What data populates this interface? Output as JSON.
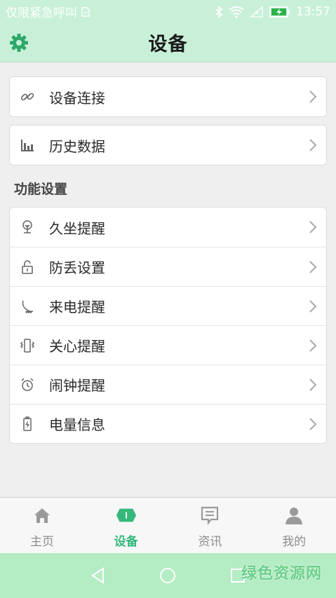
{
  "status_bar": {
    "carrier_text": "仅限紧急呼叫",
    "time": "13:57"
  },
  "header": {
    "title": "设备",
    "settings_icon": "gear-icon"
  },
  "top_items": [
    {
      "label": "设备连接",
      "icon": "link-icon"
    },
    {
      "label": "历史数据",
      "icon": "bar-chart-icon"
    }
  ],
  "function_section": {
    "title": "功能设置",
    "items": [
      {
        "label": "久坐提醒",
        "icon": "tree-icon"
      },
      {
        "label": "防丢设置",
        "icon": "unlock-icon"
      },
      {
        "label": "来电提醒",
        "icon": "phone-icon"
      },
      {
        "label": "关心提醒",
        "icon": "vibrate-icon"
      },
      {
        "label": "闹钟提醒",
        "icon": "alarm-icon"
      },
      {
        "label": "电量信息",
        "icon": "battery-icon"
      }
    ]
  },
  "tabs": [
    {
      "label": "主页",
      "icon": "home-icon",
      "active": false
    },
    {
      "label": "设备",
      "icon": "device-icon",
      "active": true
    },
    {
      "label": "资讯",
      "icon": "message-icon",
      "active": false
    },
    {
      "label": "我的",
      "icon": "user-icon",
      "active": false
    }
  ],
  "watermark": "绿色资源网",
  "colors": {
    "header_bg": "#c8f0d8",
    "accent": "#35b87a",
    "nav_bg": "#b4ecc4"
  }
}
